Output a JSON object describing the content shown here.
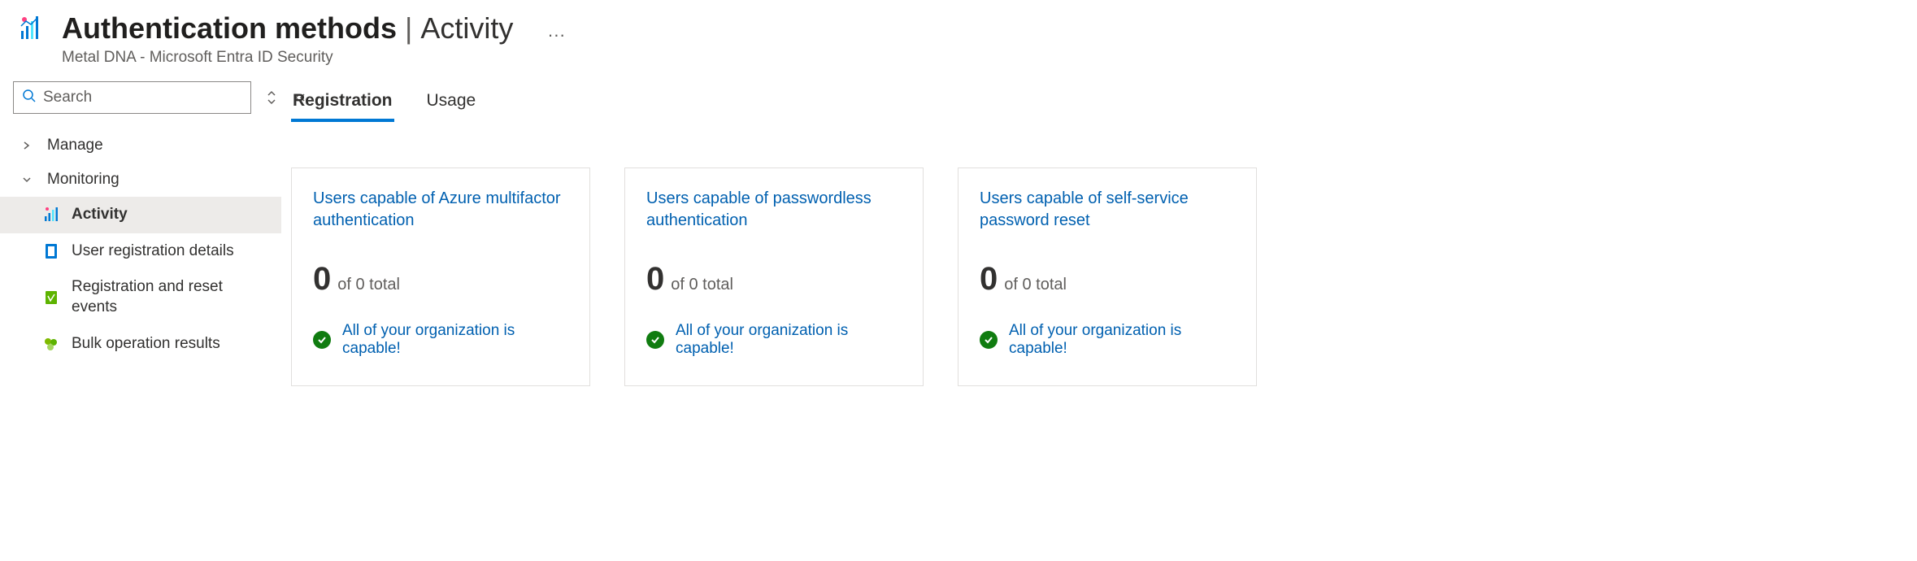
{
  "header": {
    "title_main": "Authentication methods",
    "title_separator": "|",
    "title_sub": "Activity",
    "subtitle": "Metal DNA - Microsoft Entra ID Security",
    "more": "···"
  },
  "search": {
    "placeholder": "Search"
  },
  "sidebar": {
    "manage_label": "Manage",
    "monitoring_label": "Monitoring",
    "items": {
      "activity": "Activity",
      "user_reg": "User registration details",
      "reg_reset": "Registration and reset events",
      "bulk": "Bulk operation results"
    }
  },
  "tabs": {
    "registration": "Registration",
    "usage": "Usage"
  },
  "cards": [
    {
      "title": "Users capable of Azure multifactor authentication",
      "big": "0",
      "rest": "of 0 total",
      "status": "All of your organization is capable!"
    },
    {
      "title": "Users capable of passwordless authentication",
      "big": "0",
      "rest": "of 0 total",
      "status": "All of your organization is capable!"
    },
    {
      "title": "Users capable of self-service password reset",
      "big": "0",
      "rest": "of 0 total",
      "status": "All of your organization is capable!"
    }
  ]
}
